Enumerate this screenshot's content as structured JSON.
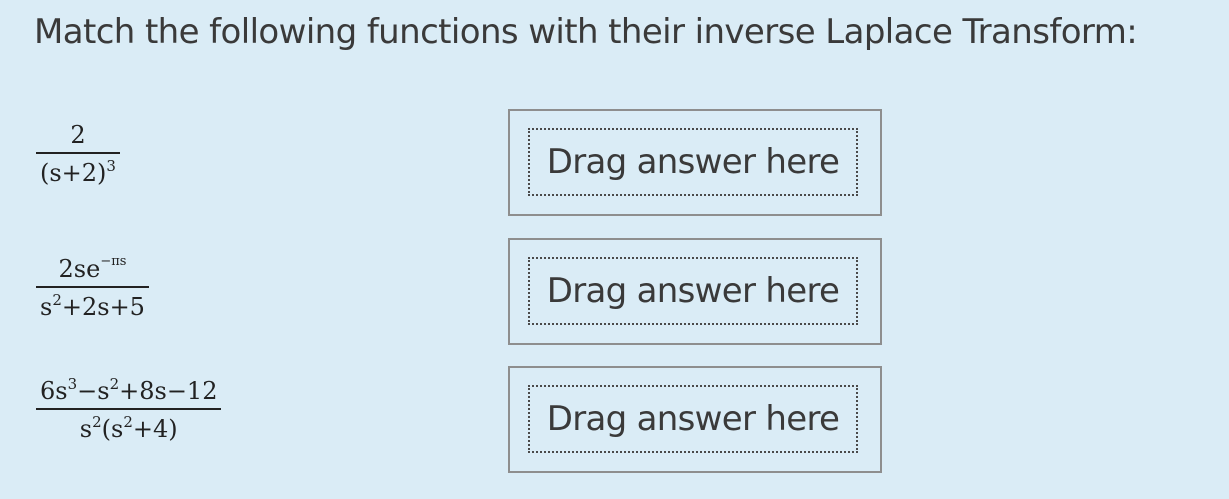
{
  "question": {
    "text": "Match the following functions with their inverse Laplace Transform:"
  },
  "functions": [
    {
      "numerator": "2",
      "denominator_main": "(s+2)",
      "denominator_sup": "3"
    },
    {
      "numerator_main": "2se",
      "numerator_sup": "−πs",
      "denominator_pre": "s",
      "denominator_sup": "2",
      "denominator_post": "+2s+5"
    },
    {
      "numerator_a": "6s",
      "numerator_sup_a": "3",
      "numerator_b": "−s",
      "numerator_sup_b": "2",
      "numerator_c": "+8s−12",
      "denominator_a": "s",
      "denominator_sup_a": "2",
      "denominator_b": "(s",
      "denominator_sup_b": "2",
      "denominator_c": "+4)"
    }
  ],
  "drop_zones": [
    {
      "label": "Drag answer here"
    },
    {
      "label": "Drag answer here"
    },
    {
      "label": "Drag answer here"
    }
  ]
}
